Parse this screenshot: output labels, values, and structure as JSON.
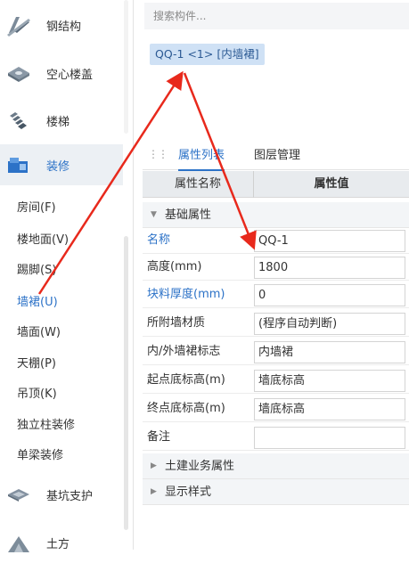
{
  "sidebar": {
    "categories": [
      {
        "label": "钢结构",
        "icon": "steel-beam-icon"
      },
      {
        "label": "空心楼盖",
        "icon": "hollow-slab-icon"
      },
      {
        "label": "楼梯",
        "icon": "stairs-icon"
      },
      {
        "label": "装修",
        "icon": "decoration-icon"
      }
    ],
    "sub_items": [
      {
        "label": "房间(F)"
      },
      {
        "label": "楼地面(V)"
      },
      {
        "label": "踢脚(S)"
      },
      {
        "label": "墙裙(U)"
      },
      {
        "label": "墙面(W)"
      },
      {
        "label": "天棚(P)"
      },
      {
        "label": "吊顶(K)"
      },
      {
        "label": "独立柱装修"
      },
      {
        "label": "单梁装修"
      }
    ],
    "bottom_categories": [
      {
        "label": "基坑支护",
        "icon": "pit-support-icon"
      },
      {
        "label": "土方",
        "icon": "earthwork-icon"
      }
    ],
    "active_sub": "墙裙(U)"
  },
  "search": {
    "placeholder": "搜索构件..."
  },
  "component": {
    "tag": "QQ-1 <1> [内墙裙]"
  },
  "tabs": [
    {
      "label": "属性列表"
    },
    {
      "label": "图层管理"
    }
  ],
  "table": {
    "headers": [
      "属性名称",
      "属性值"
    ],
    "group_basic": "基础属性",
    "rows": [
      {
        "name": "名称",
        "value": "QQ-1"
      },
      {
        "name": "高度(mm)",
        "value": "1800"
      },
      {
        "name": "块料厚度(mm)",
        "value": "0"
      },
      {
        "name": "所附墙材质",
        "value": "(程序自动判断)"
      },
      {
        "name": "内/外墙裙标志",
        "value": "内墙裙"
      },
      {
        "name": "起点底标高(m)",
        "value": "墙底标高"
      },
      {
        "name": "终点底标高(m)",
        "value": "墙底标高"
      },
      {
        "name": "备注",
        "value": ""
      }
    ],
    "group_civil": "土建业务属性",
    "group_display": "显示样式"
  },
  "colors": {
    "accent": "#2c72c7",
    "annotation_arrow": "#e8291c",
    "tag_bg": "#cfe1f5"
  }
}
